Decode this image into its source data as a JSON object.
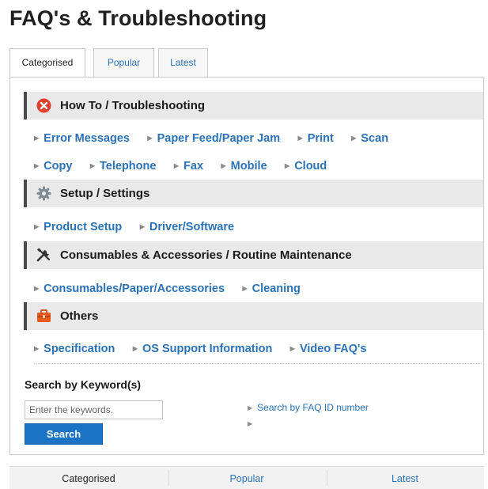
{
  "page": {
    "title": "FAQ's & Troubleshooting"
  },
  "tabs": [
    {
      "label": "Categorised",
      "active": true
    },
    {
      "label": "Popular",
      "active": false
    },
    {
      "label": "Latest",
      "active": false
    }
  ],
  "sections": [
    {
      "title": "How To / Troubleshooting",
      "icon": "error-x-icon",
      "rows": [
        [
          "Error Messages",
          "Paper Feed/Paper Jam",
          "Print",
          "Scan"
        ],
        [
          "Copy",
          "Telephone",
          "Fax",
          "Mobile",
          "Cloud"
        ]
      ]
    },
    {
      "title": "Setup / Settings",
      "icon": "gear-icon",
      "rows": [
        [
          "Product Setup",
          "Driver/Software"
        ]
      ]
    },
    {
      "title": "Consumables & Accessories / Routine Maintenance",
      "icon": "tools-icon",
      "rows": [
        [
          "Consumables/Paper/Accessories",
          "Cleaning"
        ]
      ]
    },
    {
      "title": "Others",
      "icon": "toolbox-icon",
      "rows": [
        [
          "Specification",
          "OS Support Information",
          "Video FAQ's"
        ]
      ]
    }
  ],
  "search": {
    "heading": "Search by Keyword(s)",
    "placeholder": "Enter the keywords.",
    "value": "",
    "button_label": "Search",
    "id_link_label": "Search by FAQ ID number"
  },
  "footer_tabs": [
    {
      "label": "Categorised",
      "active": true
    },
    {
      "label": "Popular",
      "active": false
    },
    {
      "label": "Latest",
      "active": false
    }
  ],
  "colors": {
    "link": "#2a72b5",
    "button": "#1b73c5",
    "section_bg": "#e9e9e9",
    "section_accent": "#4a4a4a",
    "error_icon": "#e0412f",
    "toolbox_icon": "#e8591e"
  }
}
